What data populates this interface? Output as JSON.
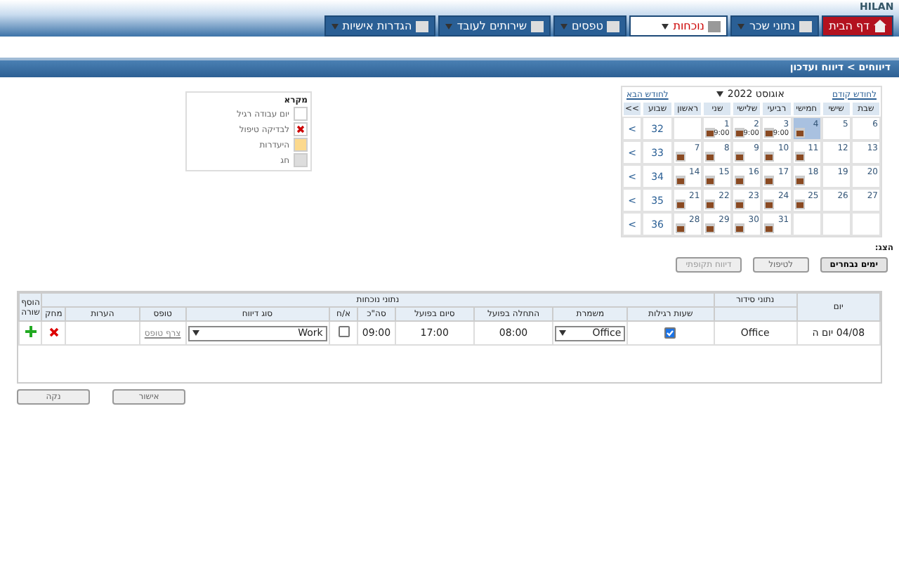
{
  "logo": {
    "text": "HILAN"
  },
  "nav": [
    {
      "label": "דף הבית",
      "kind": "home",
      "selected": false
    },
    {
      "label": "נתוני שכר",
      "kind": "menu",
      "selected": false
    },
    {
      "label": "נוכחות",
      "kind": "menu",
      "selected": true
    },
    {
      "label": "טפסים",
      "kind": "menu",
      "selected": false
    },
    {
      "label": "שירותים לעובד",
      "kind": "menu",
      "selected": false
    },
    {
      "label": "הגדרות אישיות",
      "kind": "menu",
      "selected": false
    }
  ],
  "breadcrumb": "דיווחים > דיווח ועדכון",
  "calendar": {
    "prev_link": "לחודש קודם",
    "month": "אוגוסט 2022",
    "next_link": "לחודש הבא",
    "headers": [
      "שבת",
      "שישי",
      "חמישי",
      "רביעי",
      "שלישי",
      "שני",
      "ראשון",
      "שבוע",
      ">>"
    ],
    "weeks": [
      {
        "days": [
          {
            "kind": "day",
            "date": "6",
            "report": false,
            "selected": false
          },
          {
            "kind": "day",
            "date": "5",
            "report": false,
            "selected": false
          },
          {
            "kind": "day",
            "date": "4",
            "report": true,
            "selected": true
          },
          {
            "kind": "day",
            "date": "3",
            "report": true,
            "time": "9:00",
            "selected": false
          },
          {
            "kind": "day",
            "date": "2",
            "report": true,
            "time": "9:00",
            "selected": false
          },
          {
            "kind": "day",
            "date": "1",
            "report": true,
            "time": "9:00",
            "selected": false
          },
          {
            "kind": "empty"
          }
        ],
        "number": "32",
        "arrow": ">"
      },
      {
        "days": [
          {
            "kind": "day",
            "date": "13",
            "report": false,
            "selected": false
          },
          {
            "kind": "day",
            "date": "12",
            "report": false,
            "selected": false
          },
          {
            "kind": "day",
            "date": "11",
            "report": true,
            "selected": false
          },
          {
            "kind": "day",
            "date": "10",
            "report": true,
            "selected": false
          },
          {
            "kind": "day",
            "date": "9",
            "report": true,
            "selected": false
          },
          {
            "kind": "day",
            "date": "8",
            "report": true,
            "selected": false
          },
          {
            "kind": "day",
            "date": "7",
            "report": true,
            "selected": false
          }
        ],
        "number": "33",
        "arrow": ">"
      },
      {
        "days": [
          {
            "kind": "day",
            "date": "20",
            "report": false,
            "selected": false
          },
          {
            "kind": "day",
            "date": "19",
            "report": false,
            "selected": false
          },
          {
            "kind": "day",
            "date": "18",
            "report": true,
            "selected": false
          },
          {
            "kind": "day",
            "date": "17",
            "report": true,
            "selected": false
          },
          {
            "kind": "day",
            "date": "16",
            "report": true,
            "selected": false
          },
          {
            "kind": "day",
            "date": "15",
            "report": true,
            "selected": false
          },
          {
            "kind": "day",
            "date": "14",
            "report": true,
            "selected": false
          }
        ],
        "number": "34",
        "arrow": ">"
      },
      {
        "days": [
          {
            "kind": "day",
            "date": "27",
            "report": false,
            "selected": false
          },
          {
            "kind": "day",
            "date": "26",
            "report": false,
            "selected": false
          },
          {
            "kind": "day",
            "date": "25",
            "report": true,
            "selected": false
          },
          {
            "kind": "day",
            "date": "24",
            "report": true,
            "selected": false
          },
          {
            "kind": "day",
            "date": "23",
            "report": true,
            "selected": false
          },
          {
            "kind": "day",
            "date": "22",
            "report": true,
            "selected": false
          },
          {
            "kind": "day",
            "date": "21",
            "report": true,
            "selected": false
          }
        ],
        "number": "35",
        "arrow": ">"
      },
      {
        "days": [
          {
            "kind": "empty"
          },
          {
            "kind": "empty"
          },
          {
            "kind": "empty"
          },
          {
            "kind": "day",
            "date": "31",
            "report": true,
            "selected": false
          },
          {
            "kind": "day",
            "date": "30",
            "report": true,
            "selected": false
          },
          {
            "kind": "day",
            "date": "29",
            "report": true,
            "selected": false
          },
          {
            "kind": "day",
            "date": "28",
            "report": true,
            "selected": false
          }
        ],
        "number": "36",
        "arrow": ">"
      }
    ]
  },
  "legend": {
    "title": "מקרא",
    "items": [
      {
        "label": "יום עבודה רגיל",
        "kind": "normal"
      },
      {
        "label": "לבדיקה טיפול",
        "kind": "check"
      },
      {
        "label": "היעדרות",
        "kind": "absence"
      },
      {
        "label": "חג",
        "kind": "holiday"
      }
    ]
  },
  "show_label": "הצג:",
  "filter_buttons": [
    {
      "label": "ימים נבחרים",
      "selected": true,
      "disabled": false
    },
    {
      "label": "לטיפול",
      "selected": false,
      "disabled": false
    },
    {
      "label": "דיווח תקופתי",
      "selected": false,
      "disabled": true
    }
  ],
  "table": {
    "day_header": "יום",
    "groups": [
      "נתוני סידור",
      "נתוני נוכחות"
    ],
    "add_header": "הוסף שורה",
    "columns": [
      "שעות רגילות",
      "משמרת",
      "התחלה בפועל",
      "סיום בפועל",
      "סה\"כ",
      "א/ח",
      "סוג דיווח",
      "טופס",
      "הערות",
      "מחק"
    ],
    "rows": [
      {
        "day": "04/08 יום ה",
        "arrangement": "Office",
        "regular_hours": true,
        "shift": "Office",
        "start": "08:00",
        "end": "17:00",
        "total": "09:00",
        "absence": false,
        "report_type": "Work",
        "form_link": "צרף טופס"
      }
    ]
  },
  "actions": [
    "אישור",
    "נקה"
  ]
}
